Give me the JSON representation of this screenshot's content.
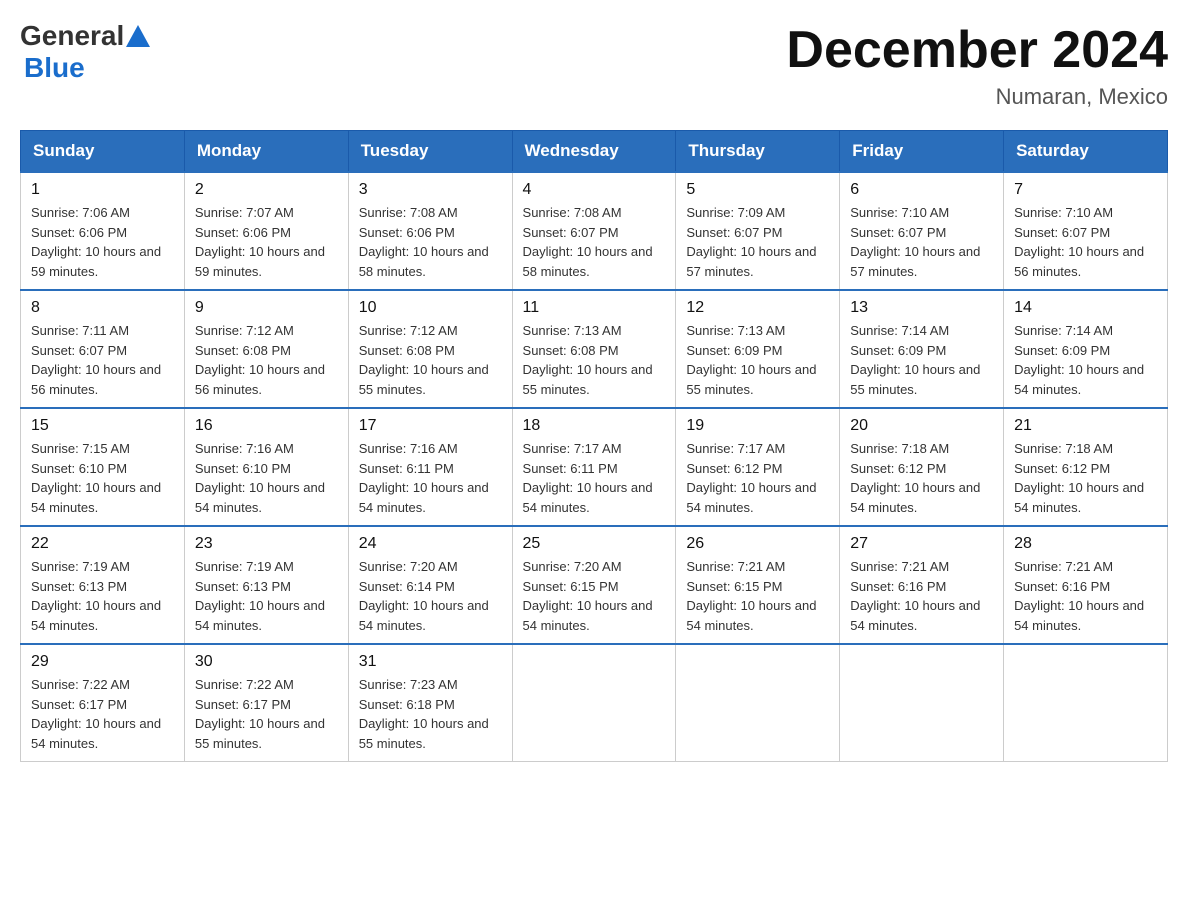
{
  "header": {
    "logo_general": "General",
    "logo_blue": "Blue",
    "month_title": "December 2024",
    "location": "Numaran, Mexico"
  },
  "days_of_week": [
    "Sunday",
    "Monday",
    "Tuesday",
    "Wednesday",
    "Thursday",
    "Friday",
    "Saturday"
  ],
  "weeks": [
    [
      {
        "day": "1",
        "sunrise": "7:06 AM",
        "sunset": "6:06 PM",
        "daylight": "10 hours and 59 minutes."
      },
      {
        "day": "2",
        "sunrise": "7:07 AM",
        "sunset": "6:06 PM",
        "daylight": "10 hours and 59 minutes."
      },
      {
        "day": "3",
        "sunrise": "7:08 AM",
        "sunset": "6:06 PM",
        "daylight": "10 hours and 58 minutes."
      },
      {
        "day": "4",
        "sunrise": "7:08 AM",
        "sunset": "6:07 PM",
        "daylight": "10 hours and 58 minutes."
      },
      {
        "day": "5",
        "sunrise": "7:09 AM",
        "sunset": "6:07 PM",
        "daylight": "10 hours and 57 minutes."
      },
      {
        "day": "6",
        "sunrise": "7:10 AM",
        "sunset": "6:07 PM",
        "daylight": "10 hours and 57 minutes."
      },
      {
        "day": "7",
        "sunrise": "7:10 AM",
        "sunset": "6:07 PM",
        "daylight": "10 hours and 56 minutes."
      }
    ],
    [
      {
        "day": "8",
        "sunrise": "7:11 AM",
        "sunset": "6:07 PM",
        "daylight": "10 hours and 56 minutes."
      },
      {
        "day": "9",
        "sunrise": "7:12 AM",
        "sunset": "6:08 PM",
        "daylight": "10 hours and 56 minutes."
      },
      {
        "day": "10",
        "sunrise": "7:12 AM",
        "sunset": "6:08 PM",
        "daylight": "10 hours and 55 minutes."
      },
      {
        "day": "11",
        "sunrise": "7:13 AM",
        "sunset": "6:08 PM",
        "daylight": "10 hours and 55 minutes."
      },
      {
        "day": "12",
        "sunrise": "7:13 AM",
        "sunset": "6:09 PM",
        "daylight": "10 hours and 55 minutes."
      },
      {
        "day": "13",
        "sunrise": "7:14 AM",
        "sunset": "6:09 PM",
        "daylight": "10 hours and 55 minutes."
      },
      {
        "day": "14",
        "sunrise": "7:14 AM",
        "sunset": "6:09 PM",
        "daylight": "10 hours and 54 minutes."
      }
    ],
    [
      {
        "day": "15",
        "sunrise": "7:15 AM",
        "sunset": "6:10 PM",
        "daylight": "10 hours and 54 minutes."
      },
      {
        "day": "16",
        "sunrise": "7:16 AM",
        "sunset": "6:10 PM",
        "daylight": "10 hours and 54 minutes."
      },
      {
        "day": "17",
        "sunrise": "7:16 AM",
        "sunset": "6:11 PM",
        "daylight": "10 hours and 54 minutes."
      },
      {
        "day": "18",
        "sunrise": "7:17 AM",
        "sunset": "6:11 PM",
        "daylight": "10 hours and 54 minutes."
      },
      {
        "day": "19",
        "sunrise": "7:17 AM",
        "sunset": "6:12 PM",
        "daylight": "10 hours and 54 minutes."
      },
      {
        "day": "20",
        "sunrise": "7:18 AM",
        "sunset": "6:12 PM",
        "daylight": "10 hours and 54 minutes."
      },
      {
        "day": "21",
        "sunrise": "7:18 AM",
        "sunset": "6:12 PM",
        "daylight": "10 hours and 54 minutes."
      }
    ],
    [
      {
        "day": "22",
        "sunrise": "7:19 AM",
        "sunset": "6:13 PM",
        "daylight": "10 hours and 54 minutes."
      },
      {
        "day": "23",
        "sunrise": "7:19 AM",
        "sunset": "6:13 PM",
        "daylight": "10 hours and 54 minutes."
      },
      {
        "day": "24",
        "sunrise": "7:20 AM",
        "sunset": "6:14 PM",
        "daylight": "10 hours and 54 minutes."
      },
      {
        "day": "25",
        "sunrise": "7:20 AM",
        "sunset": "6:15 PM",
        "daylight": "10 hours and 54 minutes."
      },
      {
        "day": "26",
        "sunrise": "7:21 AM",
        "sunset": "6:15 PM",
        "daylight": "10 hours and 54 minutes."
      },
      {
        "day": "27",
        "sunrise": "7:21 AM",
        "sunset": "6:16 PM",
        "daylight": "10 hours and 54 minutes."
      },
      {
        "day": "28",
        "sunrise": "7:21 AM",
        "sunset": "6:16 PM",
        "daylight": "10 hours and 54 minutes."
      }
    ],
    [
      {
        "day": "29",
        "sunrise": "7:22 AM",
        "sunset": "6:17 PM",
        "daylight": "10 hours and 54 minutes."
      },
      {
        "day": "30",
        "sunrise": "7:22 AM",
        "sunset": "6:17 PM",
        "daylight": "10 hours and 55 minutes."
      },
      {
        "day": "31",
        "sunrise": "7:23 AM",
        "sunset": "6:18 PM",
        "daylight": "10 hours and 55 minutes."
      },
      null,
      null,
      null,
      null
    ]
  ]
}
